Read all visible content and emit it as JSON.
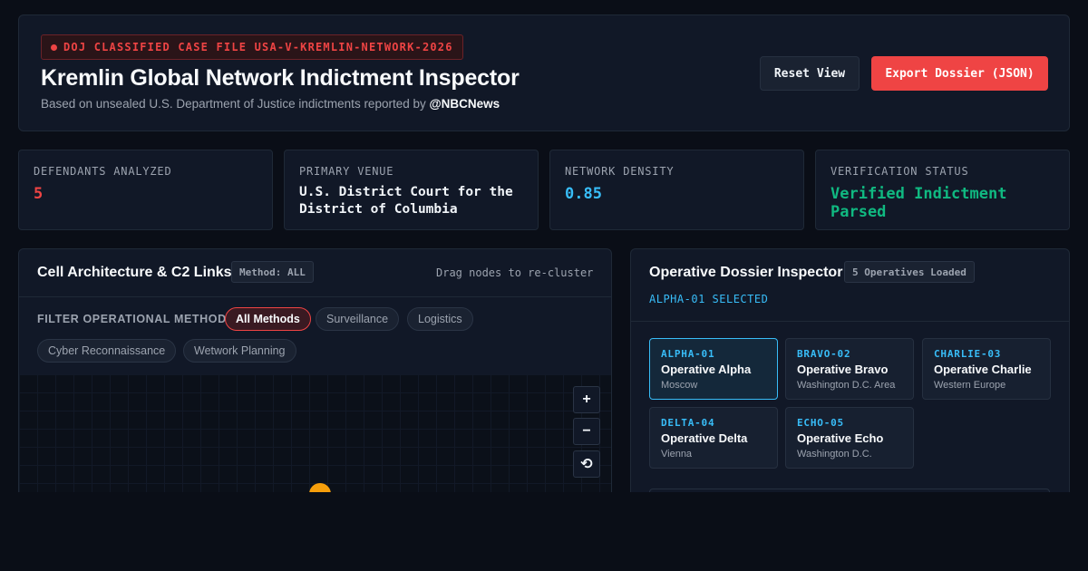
{
  "header": {
    "case_badge": "DOJ CLASSIFIED CASE FILE USA-V-KREMLIN-NETWORK-2026",
    "title": "Kremlin Global Network Indictment Inspector",
    "subtitle_prefix": "Based on unsealed U.S. Department of Justice indictments reported by ",
    "subtitle_handle": "@NBCNews",
    "reset_label": "Reset View",
    "export_label": "Export Dossier (JSON)"
  },
  "stats": [
    {
      "label": "DEFENDANTS ANALYZED",
      "value": "5",
      "color": "#ef4444"
    },
    {
      "label": "PRIMARY VENUE",
      "value": "U.S. District Court for the District of Columbia",
      "color": "#f1f5f9"
    },
    {
      "label": "NETWORK DENSITY",
      "value": "0.85",
      "color": "#38bdf8"
    },
    {
      "label": "VERIFICATION STATUS",
      "value": "Verified Indictment Parsed",
      "color": "#10b981"
    }
  ],
  "network_panel": {
    "title": "Cell Architecture & C2 Links",
    "method_tag": "Method: ALL",
    "hint": "Drag nodes to re-cluster",
    "filter_label": "FILTER OPERATIONAL METHOD:",
    "filters": [
      "All Methods",
      "Surveillance",
      "Logistics",
      "Cyber Reconnaissance",
      "Wetwork Planning"
    ],
    "active_filter": "All Methods",
    "zoom_in": "+",
    "zoom_out": "−",
    "zoom_reset": "⟲"
  },
  "dossier_panel": {
    "title": "Operative Dossier Inspector",
    "count_tag": "5 Operatives Loaded",
    "selected_label": "ALPHA-01 SELECTED",
    "operatives": [
      {
        "code": "ALPHA-01",
        "name": "Operative Alpha",
        "location": "Moscow"
      },
      {
        "code": "BRAVO-02",
        "name": "Operative Bravo",
        "location": "Washington D.C. Area"
      },
      {
        "code": "CHARLIE-03",
        "name": "Operative Charlie",
        "location": "Western Europe"
      },
      {
        "code": "DELTA-04",
        "name": "Operative Delta",
        "location": "Vienna"
      },
      {
        "code": "ECHO-05",
        "name": "Operative Echo",
        "location": "Washington D.C."
      }
    ]
  },
  "colors": {
    "accent_red": "#ef4444",
    "accent_blue": "#38bdf8",
    "accent_green": "#10b981",
    "node_orange": "#f59e0b"
  }
}
